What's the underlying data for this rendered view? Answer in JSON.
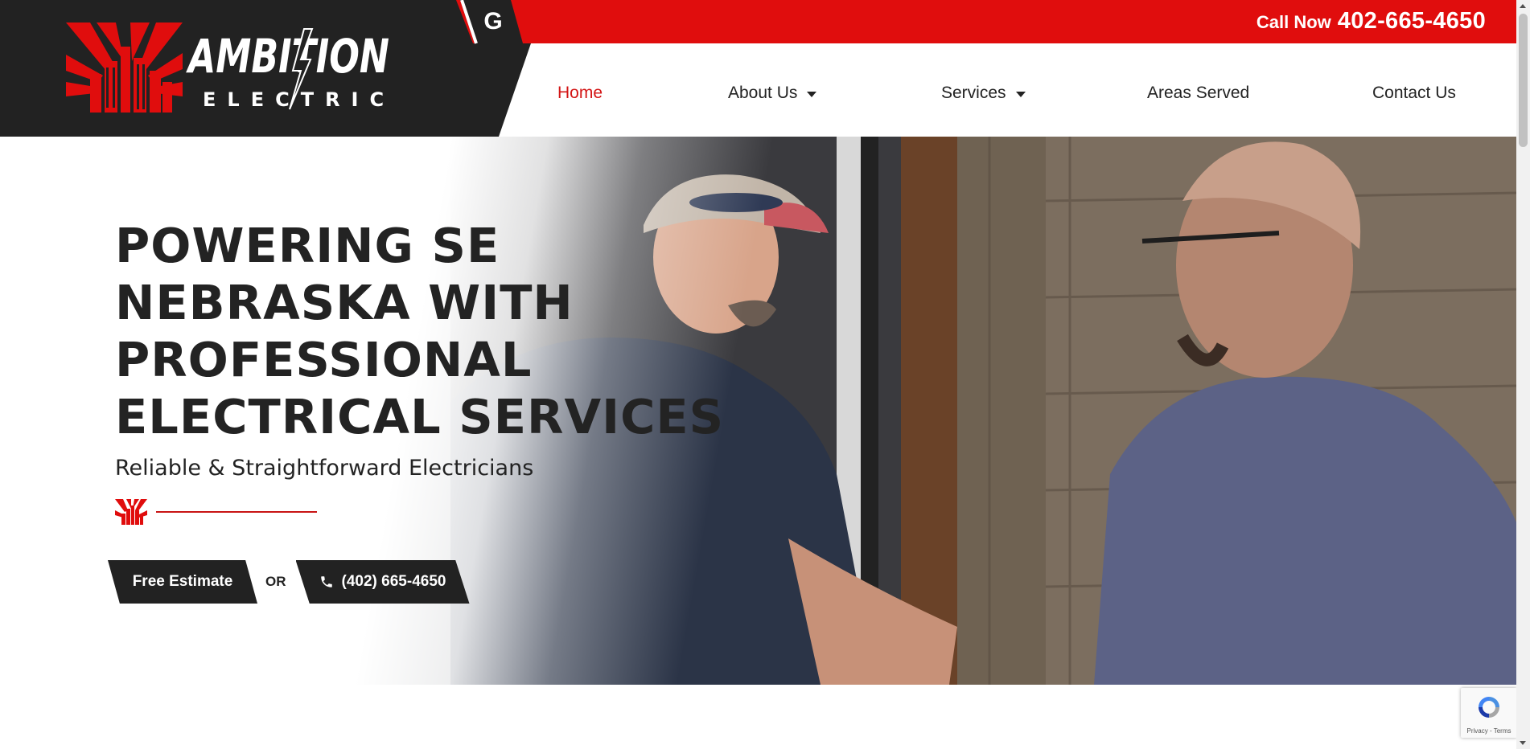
{
  "header": {
    "call_label": "Call Now",
    "call_number": "402-665-4650",
    "google_badge": "G",
    "logo": {
      "brand_top": "AMBITION",
      "brand_bottom": "ELECTRIC",
      "accent_color": "#e00d0d"
    }
  },
  "nav": {
    "items": [
      {
        "label": "Home",
        "active": true,
        "has_dropdown": false
      },
      {
        "label": "About Us",
        "active": false,
        "has_dropdown": true
      },
      {
        "label": "Services",
        "active": false,
        "has_dropdown": true
      },
      {
        "label": "Areas Served",
        "active": false,
        "has_dropdown": false
      },
      {
        "label": "Contact Us",
        "active": false,
        "has_dropdown": false
      }
    ]
  },
  "hero": {
    "headline_lines": [
      "POWERING SE",
      "NEBRASKA WITH",
      "PROFESSIONAL",
      "ELECTRICAL SERVICES"
    ],
    "subheadline": "Reliable & Straightforward Electricians",
    "cta_estimate": "Free Estimate",
    "cta_or": "OR",
    "cta_phone": "(402) 665-4650"
  },
  "recaptcha": {
    "terms": "Privacy - Terms"
  },
  "colors": {
    "brand_red": "#e00d0d",
    "dark": "#222222",
    "active_nav": "#d31515"
  }
}
